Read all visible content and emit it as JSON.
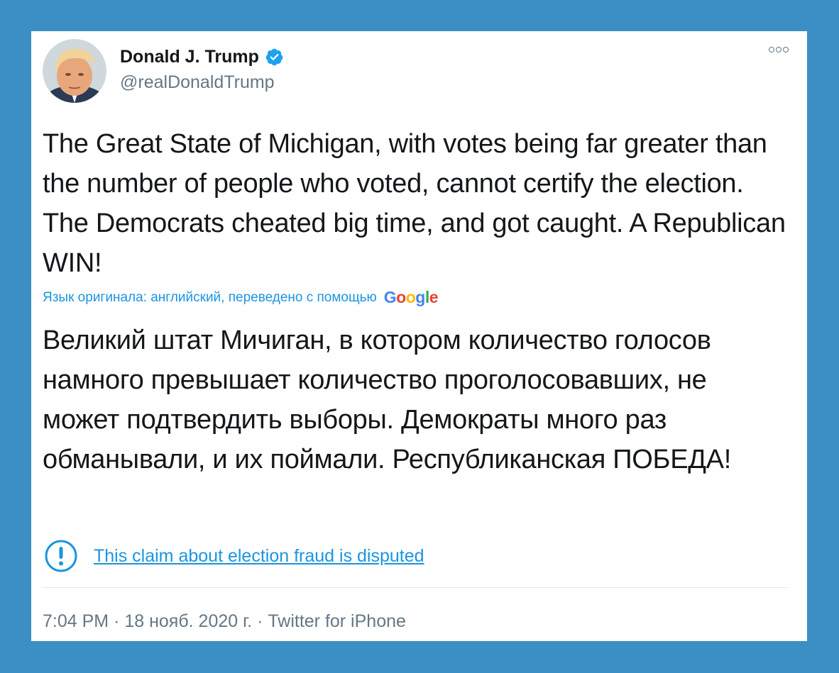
{
  "author": {
    "name": "Donald J. Trump",
    "handle": "@realDonaldTrump",
    "verified_icon": "verified-badge-icon",
    "colors": {
      "verified": "#1da1f2"
    }
  },
  "tweet": {
    "text": "The Great State of Michigan, with votes being far greater than the number of people who voted, cannot certify the election. The Democrats cheated big time, and got caught. A Republican WIN!",
    "translation_note": "Язык оригинала: английский, переведено с помощью",
    "translation_provider": "Google",
    "translated_text": "Великий штат Мичиган, в котором количество голосов намного превышает количество проголосовавших, не может подтвердить выборы. Демократы много раз обманывали, и их поймали. Республиканская ПОБЕДА!"
  },
  "notice": {
    "icon": "exclamation-circle-icon",
    "label": "This claim about election fraud is disputed"
  },
  "meta": {
    "time": "7:04 PM",
    "separator": "·",
    "date": "18 нояб. 2020 г.",
    "source": "Twitter for iPhone"
  },
  "colors": {
    "background": "#3b8fc4",
    "card": "#ffffff",
    "link": "#1b95e0",
    "text": "#14171a",
    "muted": "#657786"
  }
}
